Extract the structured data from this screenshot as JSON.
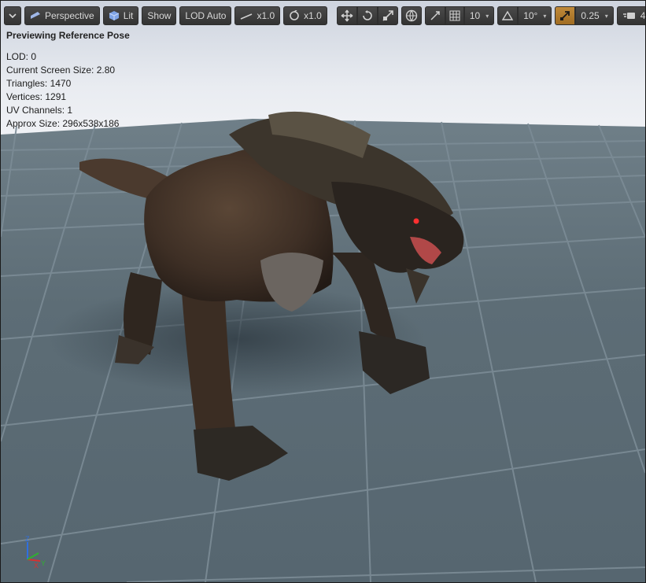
{
  "toolbar": {
    "menu_icon": "chevron-down-icon",
    "perspective_label": "Perspective",
    "lit_label": "Lit",
    "show_label": "Show",
    "lod_label": "LOD Auto",
    "speed_label": "x1.0",
    "rotation_speed_label": "x1.0",
    "grid_snap_value": "10",
    "angle_snap_value": "10°",
    "scale_snap_value": "0.25",
    "camera_speed_value": "4",
    "accent_color": "#b07a2c"
  },
  "viewport": {
    "preview_text": "Previewing Reference Pose",
    "stats": [
      "LOD: 0",
      "Current Screen Size: 2.80",
      "Triangles: 1470",
      "Vertices: 1291",
      "UV Channels: 1",
      "Approx Size: 296x538x186"
    ],
    "axis_labels": [
      "Z",
      "X",
      "Y"
    ]
  }
}
